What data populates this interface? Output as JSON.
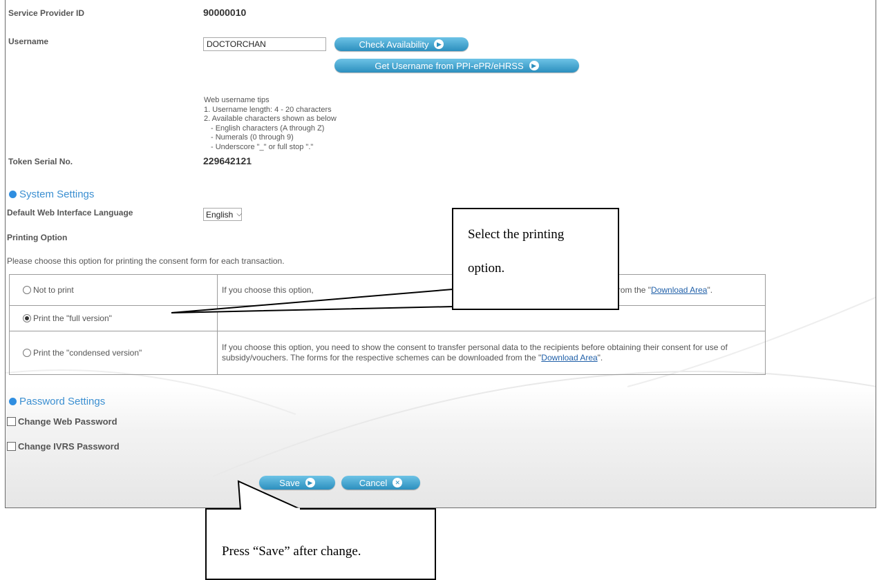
{
  "form": {
    "service_provider_id_label": "Service Provider ID",
    "service_provider_id_value": "90000010",
    "username_label": "Username",
    "username_value": "DOCTORCHAN",
    "check_availability_button": "Check Availability",
    "get_username_button": "Get Username from PPI-ePR/eHRSS",
    "tips": [
      "Web username tips",
      "1. Username length: 4 - 20 characters",
      "2. Available characters shown as below",
      "- English characters (A through Z)",
      "- Numerals (0 through 9)",
      "- Underscore \"_\" or full stop \".\""
    ],
    "token_label": "Token Serial No.",
    "token_value": "229642121"
  },
  "system_settings": {
    "title": "System Settings",
    "language_label": "Default Web Interface Language",
    "language_selected": "English",
    "printing_option_label": "Printing Option",
    "printing_description": "Please choose this option for printing the consent form for each transaction.",
    "options": [
      {
        "label": "Not to print",
        "selected": false,
        "desc_prefix": "If you choose this option, ",
        "desc_suffix": "from the \"",
        "link": "Download Area",
        "desc_end": "\"."
      },
      {
        "label": "Print the \"full version\"",
        "selected": true
      },
      {
        "label": "Print the \"condensed version\"",
        "selected": false,
        "desc": "If you choose this option, you need to show the consent to transfer personal data to the recipients before obtaining their consent for use of subsidy/vouchers. The forms for the respective schemes can be downloaded from the \"",
        "link": "Download Area",
        "desc_end": "\"."
      }
    ]
  },
  "password_settings": {
    "title": "Password Settings",
    "change_web": "Change Web Password",
    "change_ivrs": "Change IVRS Password"
  },
  "actions": {
    "save": "Save",
    "cancel": "Cancel"
  },
  "callouts": {
    "printing": [
      "Select the printing",
      "option."
    ],
    "save": "Press “Save” after change."
  },
  "colors": {
    "accent": "#3b8fd1",
    "button": "#2c8fbe",
    "link": "#1f5fa8"
  }
}
